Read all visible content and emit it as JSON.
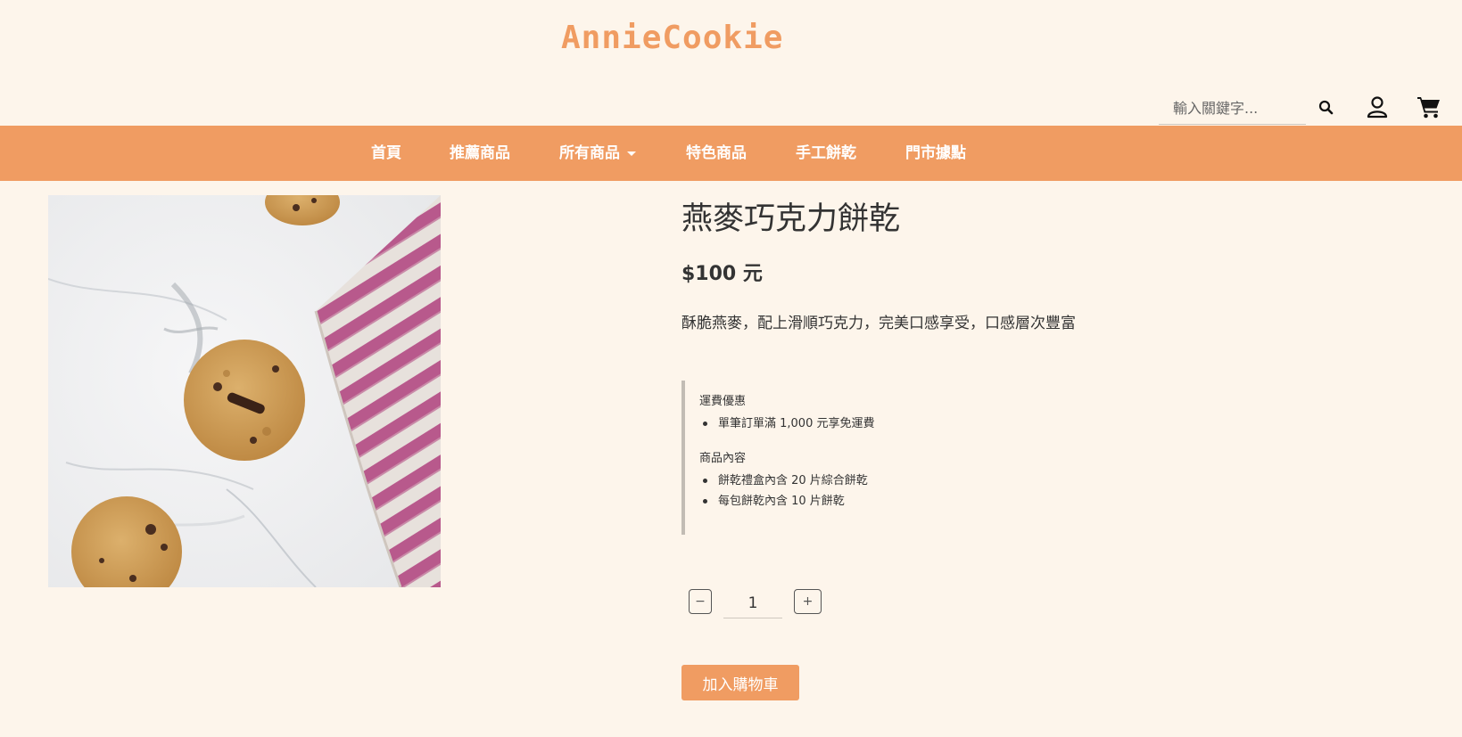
{
  "brand": {
    "name": "AnnieCookie"
  },
  "search": {
    "placeholder": "輸入關鍵字..."
  },
  "icons": {
    "search": "search-icon",
    "user": "user-icon",
    "cart": "cart-icon"
  },
  "nav": {
    "items": [
      {
        "label": "首頁"
      },
      {
        "label": "推薦商品"
      },
      {
        "label": "所有商品",
        "dropdown": true
      },
      {
        "label": "特色商品"
      },
      {
        "label": "手工餅乾"
      },
      {
        "label": "門市據點"
      }
    ]
  },
  "product": {
    "title": "燕麥巧克力餅乾",
    "price": "$100 元",
    "description": "酥脆燕麥，配上滑順巧克力，完美口感享受，口感層次豐富",
    "shipping": {
      "heading": "運費優惠",
      "items": [
        "單筆訂單滿 1,000 元享免運費"
      ]
    },
    "contents": {
      "heading": "商品內容",
      "items": [
        "餅乾禮盒內含 20 片綜合餅乾",
        "每包餅乾內含 10 片餅乾"
      ]
    }
  },
  "quantity": {
    "minus_label": "−",
    "value": "1",
    "plus_label": "+"
  },
  "cart": {
    "add_label": "加入購物車"
  },
  "colors": {
    "accent": "#f09c62",
    "background": "#fdf5eb",
    "text": "#333333"
  }
}
